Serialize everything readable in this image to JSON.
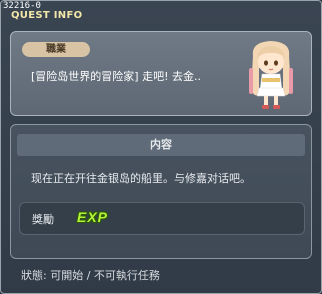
{
  "window": {
    "quest_id": "32216-0",
    "title": "QUEST INFO"
  },
  "header": {
    "job_label": "職業",
    "quest_name": "[冒险岛世界的冒险家] 走吧! 去金..",
    "npc_icon": "npc-girl-portrait"
  },
  "content": {
    "heading": "内容",
    "description": "现在正在开往金银岛的船里。与修嘉对话吧。"
  },
  "reward": {
    "label": "獎勵",
    "exp_text": "EXP",
    "exp_color": "#b6f23a"
  },
  "status": {
    "text": "狀態: 可開始 / 不可執行任務"
  }
}
